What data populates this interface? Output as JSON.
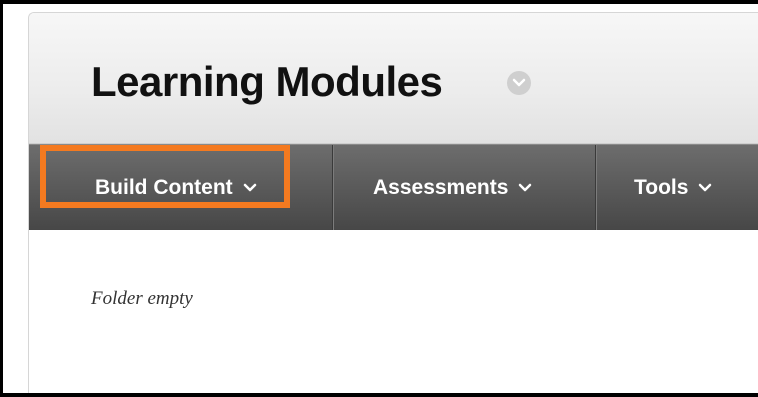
{
  "page": {
    "title": "Learning Modules"
  },
  "actionbar": {
    "items": [
      {
        "label": "Build Content"
      },
      {
        "label": "Assessments"
      },
      {
        "label": "Tools"
      }
    ]
  },
  "content": {
    "empty_message": "Folder empty"
  },
  "colors": {
    "highlight": "#f47a20",
    "actionbar": "#5a5a5a"
  }
}
